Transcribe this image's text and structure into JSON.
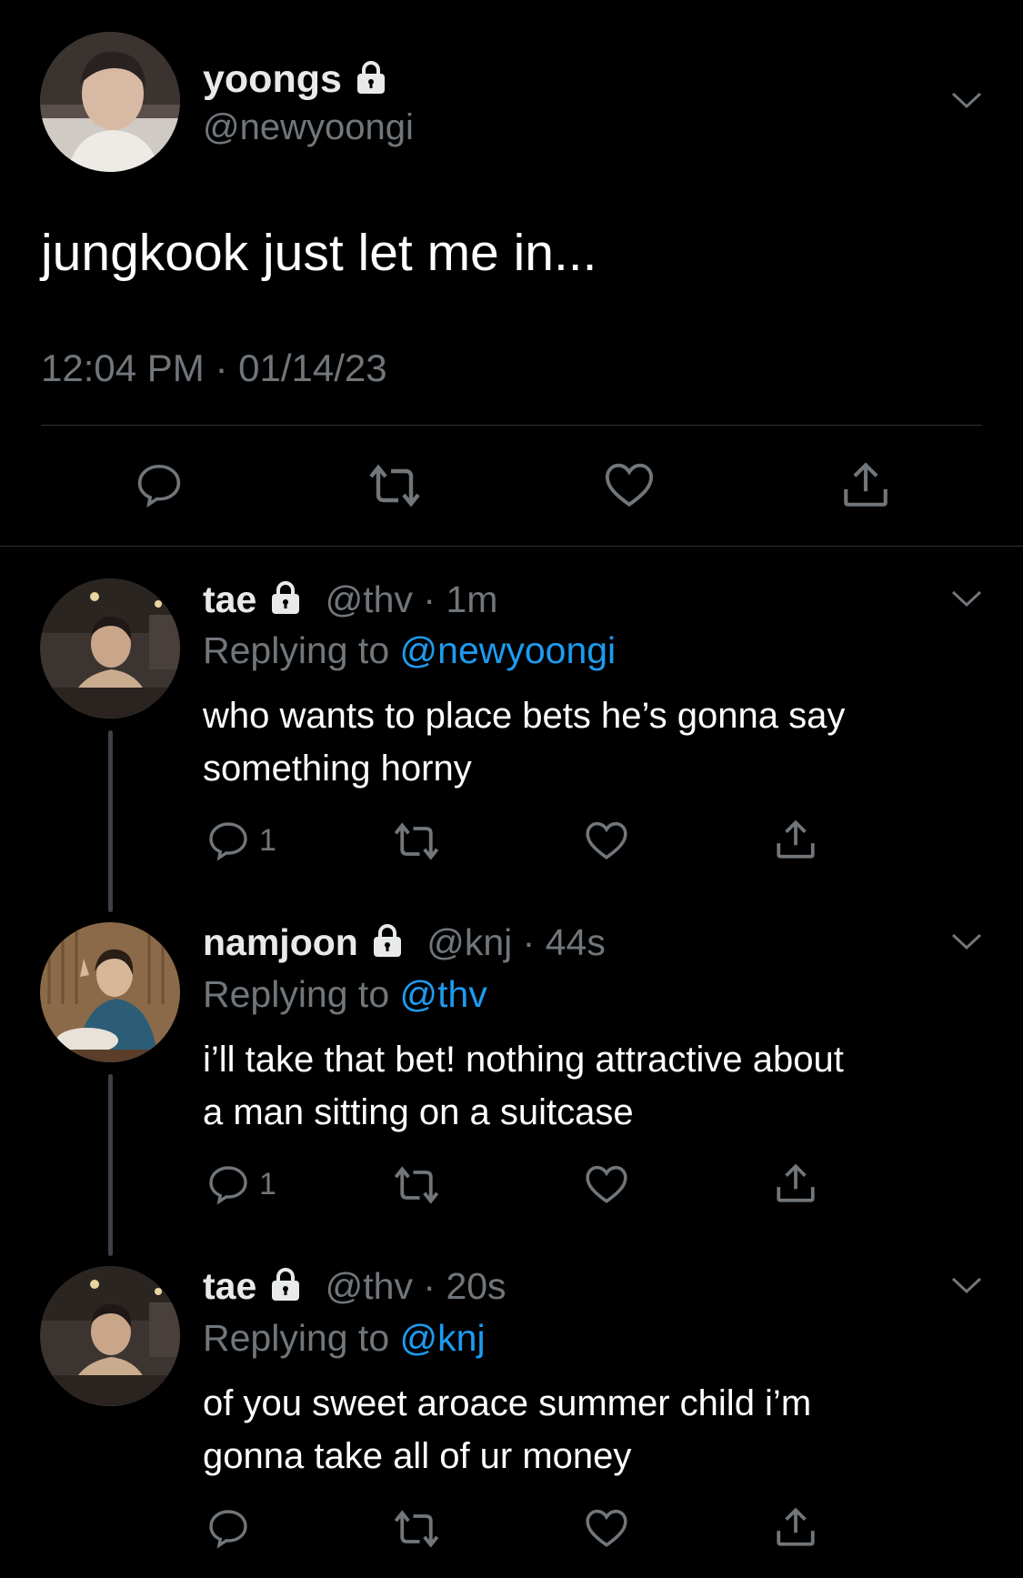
{
  "main_tweet": {
    "name": "yoongs",
    "handle": "@newyoongi",
    "text": "jungkook just let me in...",
    "timestamp": "12:04 PM · 01/14/23",
    "locked": true
  },
  "replies": [
    {
      "name": "tae",
      "handle": "@thv",
      "time": "1m",
      "replying_label": "Replying to ",
      "replying_to": "@newyoongi",
      "text_line1": "who wants to place bets he’s gonna say",
      "text_line2": "something horny",
      "reply_count": "1"
    },
    {
      "name": "namjoon",
      "handle": "@knj",
      "time": "44s",
      "replying_label": "Replying to ",
      "replying_to": "@thv",
      "text_line1": "i’ll take that bet! nothing attractive about",
      "text_line2": "a man sitting on a suitcase",
      "reply_count": "1"
    },
    {
      "name": "tae",
      "handle": "@thv",
      "time": "20s",
      "replying_label": "Replying to ",
      "replying_to": "@knj",
      "text_line1": "of you sweet aroace summer child i’m",
      "text_line2": "gonna take all of ur money",
      "reply_count": ""
    }
  ],
  "separator": " · ",
  "colors": {
    "background": "#000000",
    "link": "#1d9bf0",
    "muted": "#71767b",
    "text": "#e7e9ea"
  },
  "icons": [
    "lock-icon",
    "chevron-down-icon",
    "reply-icon",
    "retweet-icon",
    "like-icon",
    "share-icon"
  ]
}
